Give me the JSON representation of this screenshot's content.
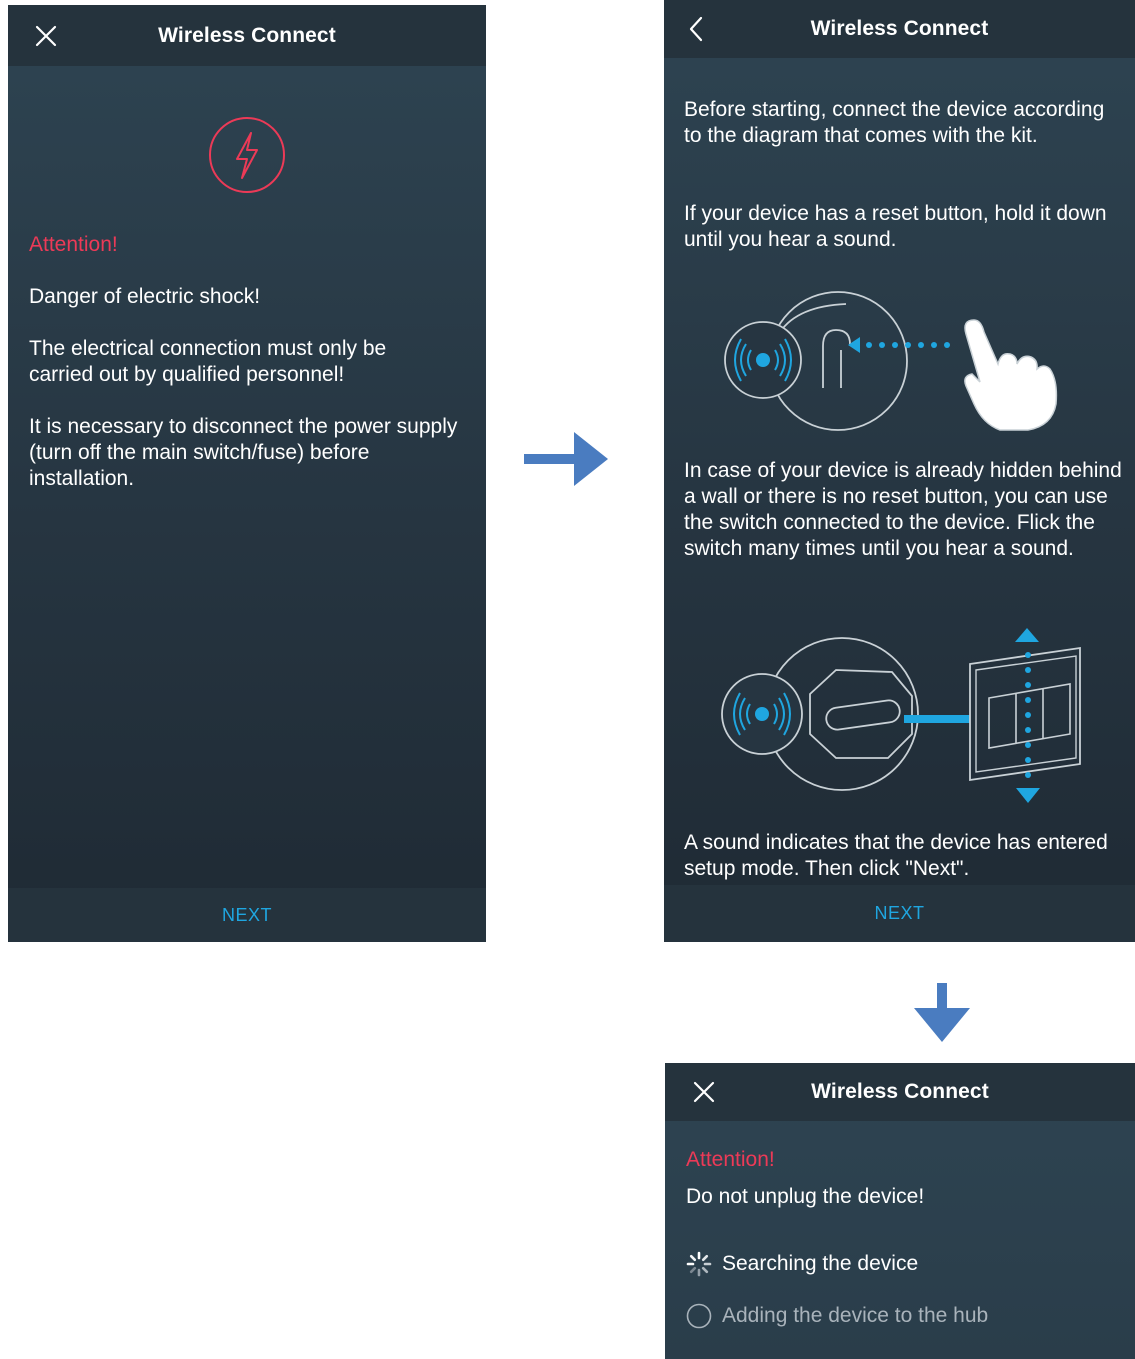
{
  "screen1": {
    "title": "Wireless Connect",
    "attention": "Attention!",
    "paragraphs": [
      "Danger of electric shock!",
      "The electrical connection must only be carried out by qualified personnel!",
      "It is necessary to disconnect the power supply (turn off the main switch/fuse) before installation."
    ],
    "next_label": "NEXT"
  },
  "screen2": {
    "title": "Wireless Connect",
    "paragraphs": [
      "Before starting, connect the device according to the diagram that comes with the kit.",
      "If your device has a reset button, hold it down until you hear a sound.",
      "In case of your device is already hidden behind a wall or there is no reset button, you can use the switch connected to the device. Flick the switch many times until you hear a sound.",
      "A sound indicates that the device has entered setup mode. Then click \"Next\"."
    ],
    "next_label": "NEXT"
  },
  "screen3": {
    "title": "Wireless Connect",
    "attention": "Attention!",
    "warning": "Do not unplug the device!",
    "steps": [
      {
        "label": "Searching the device",
        "state": "in-progress"
      },
      {
        "label": "Adding the device to the hub",
        "state": "pending"
      }
    ]
  },
  "colors": {
    "accent": "#1fa6e0",
    "attention": "#ec3a57",
    "flow_arrow": "#4a7cc0",
    "bar": "#25333d"
  },
  "icons": [
    "close-icon",
    "back-chevron-icon",
    "lightning-icon",
    "spinner-icon",
    "empty-circle-icon"
  ]
}
